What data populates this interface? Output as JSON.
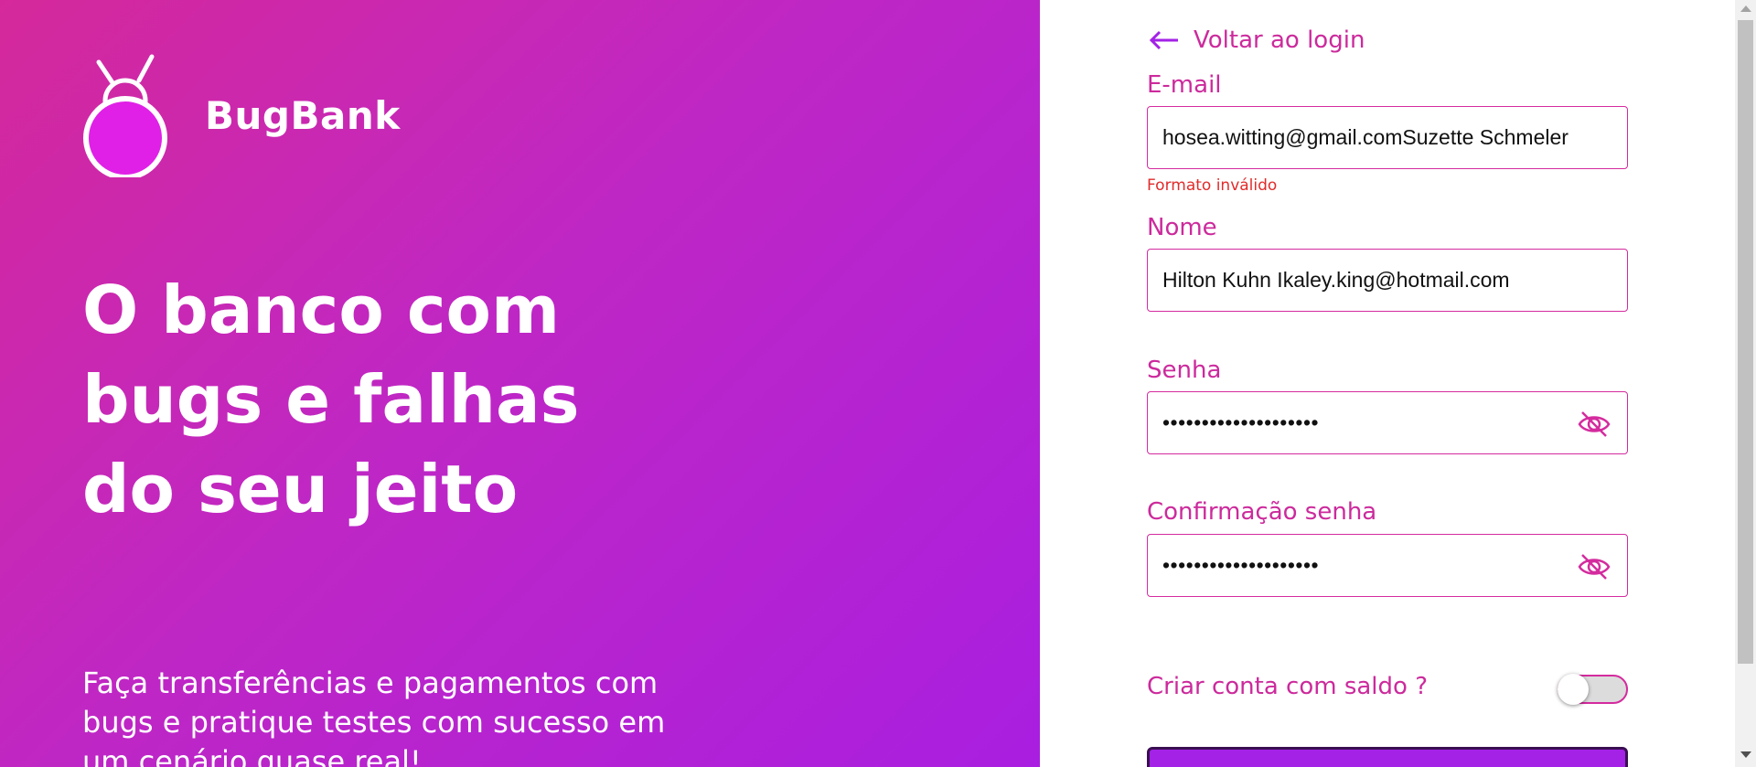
{
  "brand": {
    "name": "BugBank",
    "logo_icon": "bug-logo-icon"
  },
  "hero": {
    "lines": [
      "O banco com",
      "bugs e falhas",
      "do seu jeito"
    ],
    "subtitle": "Faça transferências e pagamentos com bugs e pratique testes com sucesso em um cenário quase real!"
  },
  "form": {
    "back_link": "Voltar ao login",
    "back_icon": "arrow-left-icon",
    "email": {
      "label": "E-mail",
      "value": "hosea.witting@gmail.comSuzette Schmeler",
      "error": "Formato inválido"
    },
    "name": {
      "label": "Nome",
      "value": "Hilton Kuhn Ikaley.king@hotmail.com"
    },
    "password": {
      "label": "Senha",
      "value": "••••••••••••••••••••"
    },
    "password_confirm": {
      "label": "Confirmação senha",
      "value": "••••••••••••••••••••"
    },
    "balance_toggle": {
      "label": "Criar conta com saldo ?",
      "on": false
    }
  },
  "colors": {
    "accent": "#cc2a9c",
    "error": "#e12b2b",
    "gradient_start": "#d5299b",
    "gradient_end": "#a91ee0",
    "button": "#a322e6"
  }
}
